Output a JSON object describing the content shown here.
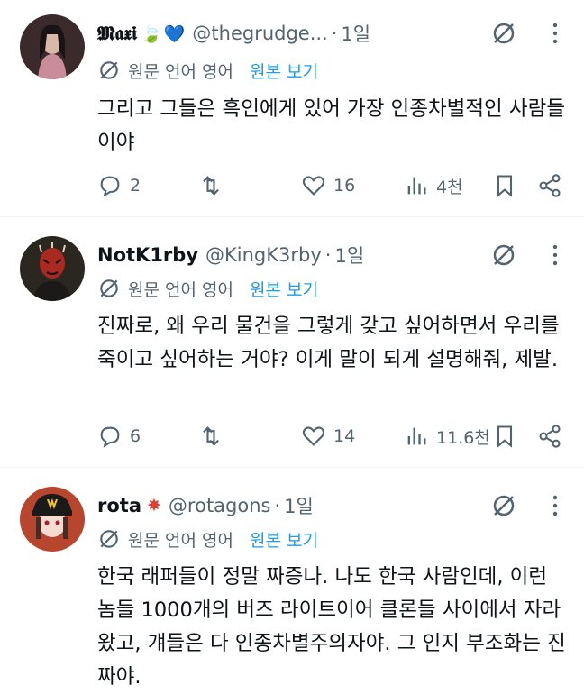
{
  "colors": {
    "text": "#0f1419",
    "secondary": "#536471",
    "link": "#1d9bf0",
    "divider": "#eff3f4"
  },
  "tweets": [
    {
      "name": "𝕸𝖆𝖝𝖎",
      "handle": "@thegrudge...",
      "time": "1일",
      "translate_lang": "원문 언어 영어",
      "translate_view": "원본 보기",
      "text": "그리고 그들은 흑인에게 있어 가장 인종차별적인 사람들이야",
      "replies": "2",
      "retweets": "",
      "likes": "16",
      "views": "4천"
    },
    {
      "name": "NotK1rby",
      "handle": "@KingK3rby",
      "time": "1일",
      "translate_lang": "원문 언어 영어",
      "translate_view": "원본 보기",
      "text": "진짜로, 왜 우리 물건을 그렇게 갖고 싶어하면서 우리를 죽이고 싶어하는 거야? 이게 말이 되게 설명해줘, 제발.",
      "replies": "6",
      "retweets": "",
      "likes": "14",
      "views": "11.6천"
    },
    {
      "name": "rota",
      "handle": "@rotagons",
      "time": "1일",
      "translate_lang": "원문 언어 영어",
      "translate_view": "원본 보기",
      "text": "한국 래퍼들이 정말 짜증나. 나도 한국 사람인데, 이런 놈들 1000개의 버즈 라이트이어 클론들 사이에서 자라왔고, 걔들은 다 인종차별주의자야. 그 인지 부조화는 진짜야."
    }
  ]
}
